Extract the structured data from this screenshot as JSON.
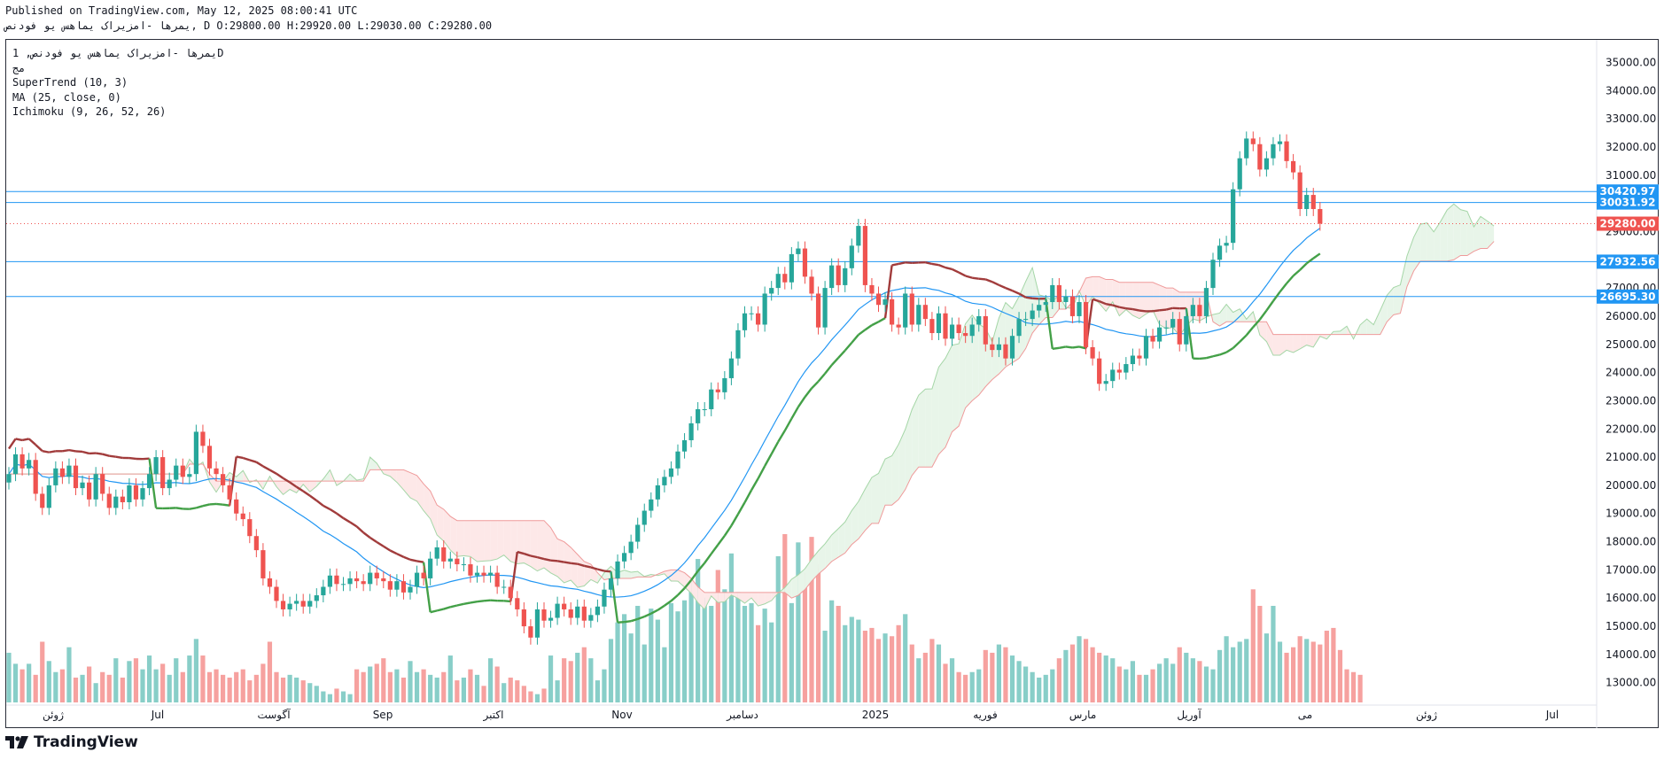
{
  "header": {
    "published": "Published on TradingView.com, May 12, 2025 08:00:41 UTC",
    "ohlc": "یمرها -امزیراک یماهس یو فودنص, D O:29800.00 H:29920.00 L:29030.00 C:29280.00"
  },
  "legend": {
    "symbol": "یمرها -امزیراک یماهس یو فودنص, 1D",
    "exchange": "مج",
    "indicators": [
      "SuperTrend (10, 3)",
      "MA (25, close, 0)",
      "Ichimoku (9, 26, 52, 26)"
    ]
  },
  "footer": {
    "brand": "TradingView"
  },
  "colors": {
    "up": "#26a69a",
    "down": "#ef5350",
    "supertrend_up": "#43a047",
    "supertrend_down": "#a13b3b",
    "ma": "#2196f3",
    "hline": "#2196f3",
    "cloud_bull": "#e8f5e9",
    "cloud_bear": "#fde8e8"
  },
  "chart_data": {
    "type": "candlestick",
    "y_range": [
      12300,
      35800
    ],
    "y_ticks": [
      13000,
      14000,
      15000,
      16000,
      17000,
      18000,
      19000,
      20000,
      21000,
      22000,
      23000,
      24000,
      25000,
      26000,
      27000,
      28000,
      29000,
      30000,
      31000,
      32000,
      33000,
      34000,
      35000
    ],
    "x_labels": [
      "ژوئن",
      "Jul",
      "آگوست",
      "Sep",
      "اکتبر",
      "Nov",
      "دسامبر",
      "2025",
      "فوریه",
      "مارس",
      "آوریل",
      "می",
      "ژوئن",
      "Jul"
    ],
    "horizontal_lines": [
      {
        "value": 30420.97,
        "label": "30420.97"
      },
      {
        "value": 30031.92,
        "label": "30031.92"
      },
      {
        "value": 27932.56,
        "label": "27932.56"
      },
      {
        "value": 26695.3,
        "label": "26695.30"
      }
    ],
    "last_price": {
      "value": 29280.0,
      "label": "29280.00"
    },
    "closes": [
      20400,
      21100,
      20600,
      20900,
      19700,
      19200,
      20000,
      20600,
      20300,
      20700,
      19900,
      20100,
      19500,
      20400,
      19700,
      19200,
      19600,
      19400,
      20000,
      19500,
      19900,
      20400,
      21000,
      19900,
      20200,
      20700,
      20300,
      20400,
      21900,
      21400,
      20600,
      20400,
      20000,
      19500,
      19000,
      18800,
      18200,
      17700,
      16700,
      16400,
      15900,
      15600,
      15800,
      15900,
      15700,
      15900,
      16100,
      16400,
      16800,
      16500,
      16500,
      16700,
      16600,
      16500,
      16900,
      16700,
      16600,
      16300,
      16600,
      16200,
      16400,
      16900,
      16700,
      17400,
      17800,
      17300,
      17400,
      17200,
      17200,
      16800,
      16900,
      16800,
      16900,
      16400,
      16400,
      16000,
      15600,
      15000,
      14600,
      15600,
      15200,
      15300,
      15800,
      15600,
      15300,
      15700,
      15200,
      15400,
      15700,
      16300,
      16700,
      17300,
      17600,
      18000,
      18600,
      19100,
      19500,
      20000,
      20300,
      20600,
      21200,
      21600,
      22200,
      22700,
      22700,
      23400,
      23300,
      23800,
      24500,
      25500,
      26100,
      26100,
      25700,
      26800,
      27000,
      27500,
      27200,
      28200,
      28400,
      27400,
      26800,
      25600,
      27000,
      27800,
      27100,
      27700,
      28500,
      29200,
      27100,
      26800,
      26400,
      26600,
      25700,
      25600,
      26800,
      25700,
      26400,
      25900,
      25400,
      26100,
      25200,
      25700,
      25400,
      25300,
      25700,
      26000,
      25000,
      24800,
      25000,
      24500,
      25300,
      25900,
      25900,
      26200,
      26400,
      26500,
      27100,
      26500,
      26700,
      26000,
      26500,
      24900,
      24500,
      23600,
      23700,
      24100,
      24000,
      24300,
      24600,
      24500,
      25300,
      25100,
      25600,
      25600,
      25900,
      25000,
      26000,
      26400,
      26000,
      27000,
      28000,
      28500,
      28600,
      30500,
      31600,
      32300,
      32100,
      31200,
      31600,
      32100,
      32200,
      31500,
      31100,
      29800,
      30300,
      29800,
      29280
    ],
    "series_volume_note": "volume bars shown at bottom, colored by candle direction",
    "volumes": [
      18,
      14,
      12,
      14,
      10,
      22,
      15,
      11,
      12,
      20,
      9,
      10,
      13,
      7,
      11,
      10,
      16,
      9,
      15,
      16,
      12,
      17,
      12,
      14,
      10,
      16,
      11,
      17,
      23,
      17,
      11,
      12,
      10,
      9,
      11,
      12,
      8,
      10,
      14,
      22,
      11,
      9,
      10,
      9,
      8,
      7,
      6,
      4,
      3,
      5,
      4,
      3,
      12,
      11,
      13,
      14,
      16,
      11,
      12,
      9,
      15,
      11,
      12,
      10,
      9,
      11,
      17,
      8,
      9,
      12,
      10,
      6,
      16,
      13,
      7,
      9,
      8,
      6,
      4,
      3,
      5,
      17,
      8,
      16,
      15,
      18,
      20,
      16,
      8,
      12,
      23,
      29,
      32,
      25,
      35,
      21,
      34,
      30,
      20,
      36,
      33,
      37,
      44,
      52,
      38,
      35,
      48,
      41,
      54,
      40,
      35,
      36,
      28,
      34,
      29,
      53,
      61,
      36,
      58,
      47,
      60,
      50,
      26,
      37,
      35,
      28,
      31,
      30,
      26,
      27,
      23,
      25,
      24,
      28,
      32,
      21,
      16,
      18,
      23,
      21,
      14,
      16,
      11,
      10,
      11,
      12,
      19,
      18,
      21,
      20,
      17,
      15,
      13,
      11,
      9,
      10,
      12,
      16,
      19,
      21,
      24,
      23,
      20,
      18,
      17,
      16,
      13,
      12,
      15,
      10,
      10,
      12,
      14,
      16,
      14,
      20,
      18,
      16,
      15,
      13,
      12,
      19,
      24,
      20,
      22,
      23,
      41,
      35,
      25,
      35,
      22,
      18,
      20,
      24,
      23,
      22,
      21,
      26,
      27,
      19,
      12,
      11,
      10
    ]
  }
}
